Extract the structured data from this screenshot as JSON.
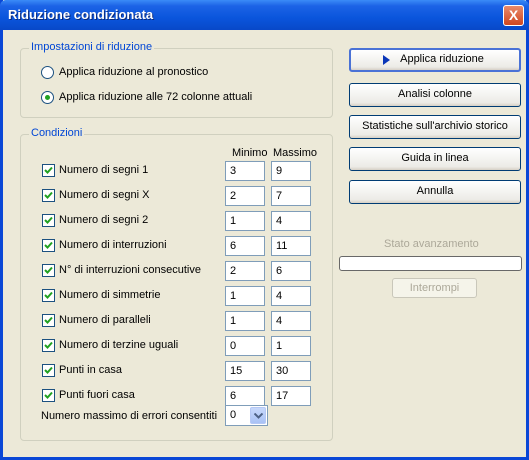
{
  "window": {
    "title": "Riduzione condizionata",
    "close_label": "X"
  },
  "settings": {
    "legend": "Impostazioni di riduzione",
    "options": [
      {
        "label": "Applica riduzione al pronostico",
        "selected": false
      },
      {
        "label": "Applica riduzione alle 72 colonne attuali",
        "selected": true
      }
    ]
  },
  "conditions": {
    "legend": "Condizioni",
    "header_min": "Minimo",
    "header_max": "Massimo",
    "rows": [
      {
        "label": "Numero di segni 1",
        "checked": true,
        "min": "3",
        "max": "9"
      },
      {
        "label": "Numero di segni X",
        "checked": true,
        "min": "2",
        "max": "7"
      },
      {
        "label": "Numero di segni 2",
        "checked": true,
        "min": "1",
        "max": "4"
      },
      {
        "label": "Numero di interruzioni",
        "checked": true,
        "min": "6",
        "max": "11"
      },
      {
        "label": "N° di interruzioni consecutive",
        "checked": true,
        "min": "2",
        "max": "6"
      },
      {
        "label": "Numero di simmetrie",
        "checked": true,
        "min": "1",
        "max": "4"
      },
      {
        "label": "Numero di paralleli",
        "checked": true,
        "min": "1",
        "max": "4"
      },
      {
        "label": "Numero di terzine uguali",
        "checked": true,
        "min": "0",
        "max": "1"
      },
      {
        "label": "Punti in casa",
        "checked": true,
        "min": "15",
        "max": "30"
      },
      {
        "label": "Punti fuori casa",
        "checked": true,
        "min": "6",
        "max": "17"
      }
    ],
    "max_errors_label": "Numero massimo di errori consentiti",
    "max_errors_value": "0"
  },
  "buttons": {
    "apply": "Applica riduzione",
    "analysis": "Analisi colonne",
    "stats": "Statistiche sull'archivio storico",
    "help": "Guida in linea",
    "cancel": "Annulla"
  },
  "progress": {
    "label": "Stato avanzamento",
    "value": 0,
    "stop_label": "Interrompi"
  },
  "colors": {
    "titlebar": "#0a55dc",
    "legend": "#0046d5",
    "check": "#21a121",
    "dialog_bg": "#ece9d8"
  }
}
